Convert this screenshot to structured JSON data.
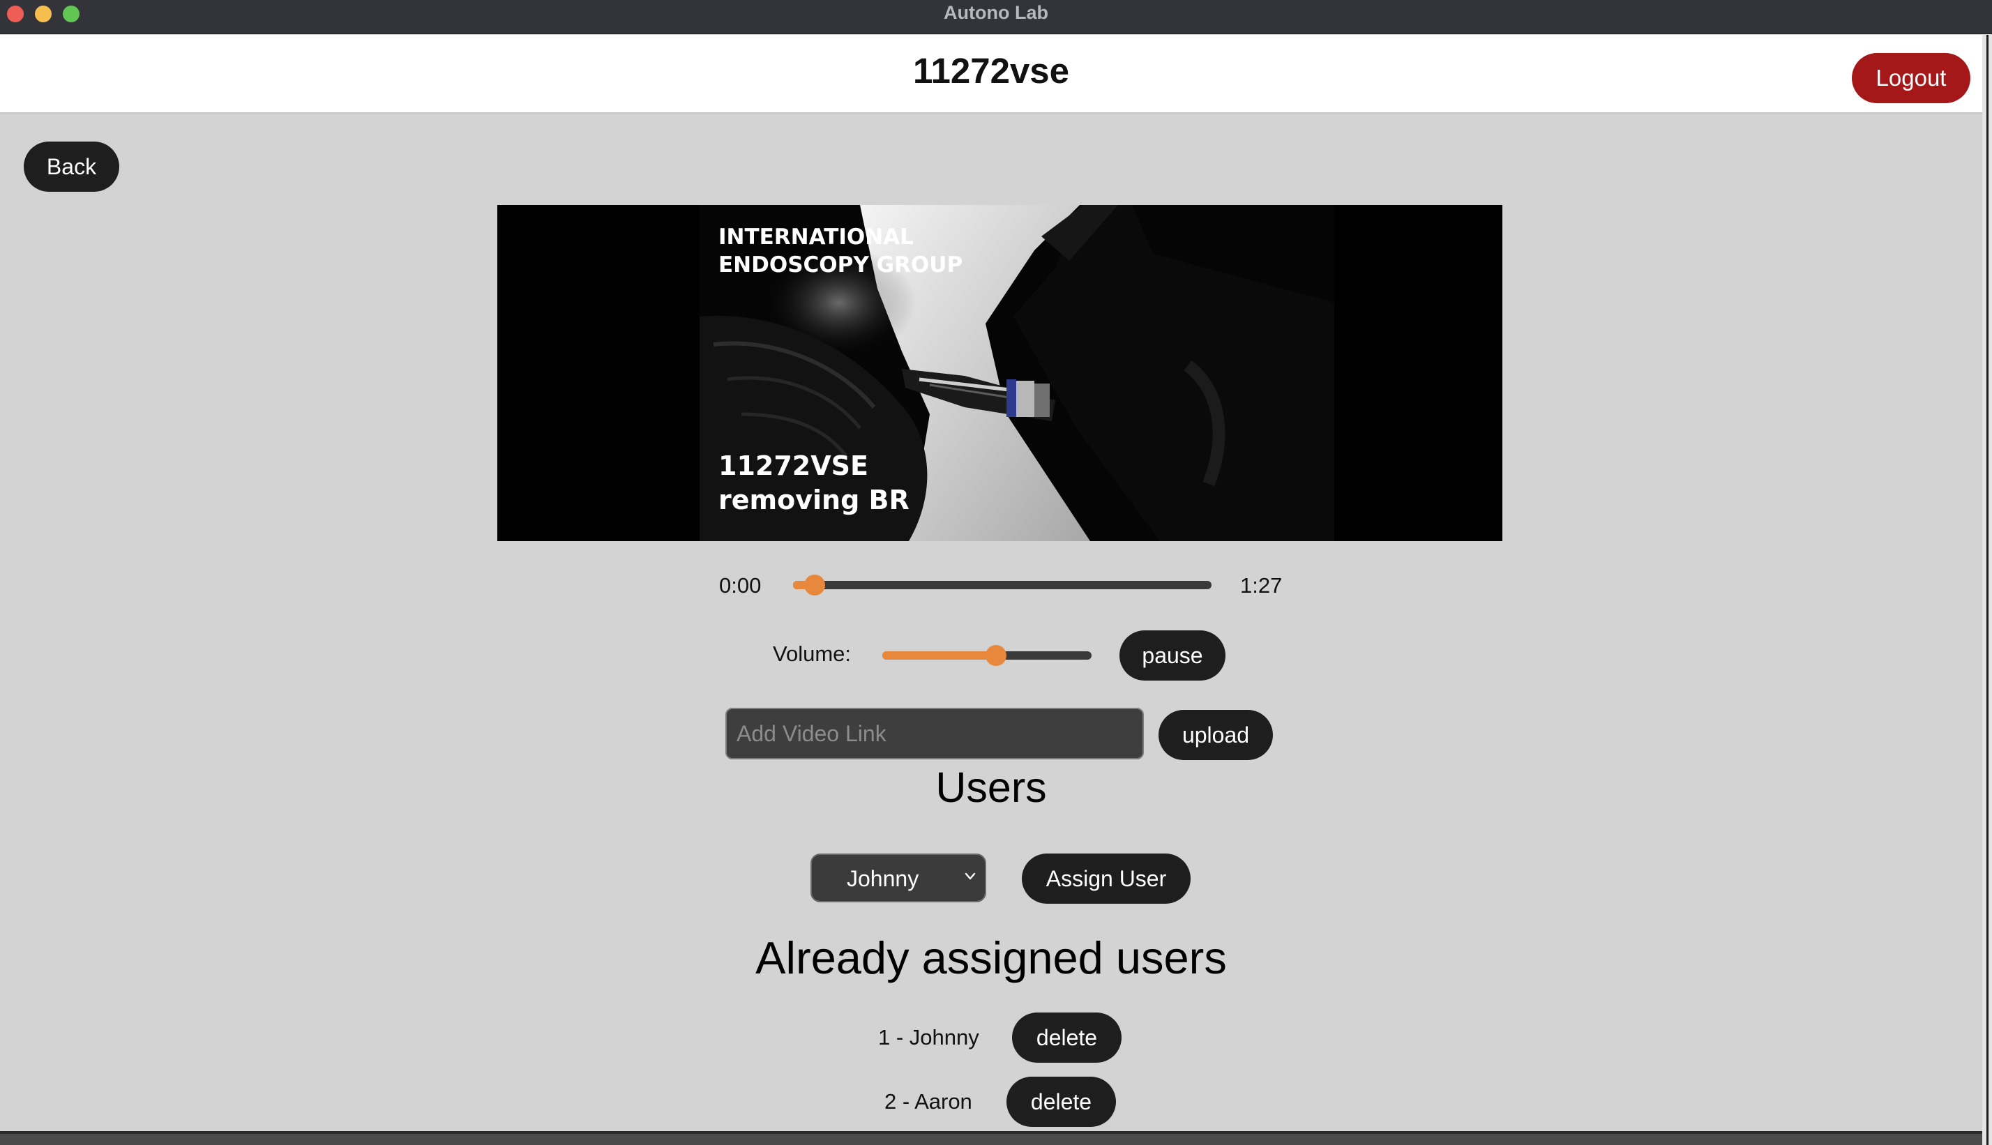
{
  "window": {
    "title": "Autono Lab"
  },
  "header": {
    "title": "11272vse",
    "logout_label": "Logout"
  },
  "nav": {
    "back_label": "Back"
  },
  "video": {
    "overlay_top_line1": "INTERNATIONAL",
    "overlay_top_line2": "ENDOSCOPY GROUP",
    "overlay_bottom_line1": "11272VSE",
    "overlay_bottom_line2": "removing BR"
  },
  "player": {
    "current_time": "0:00",
    "duration": "1:27",
    "seek_fraction": 0.03,
    "volume_label": "Volume:",
    "volume_fraction": 0.5,
    "pause_label": "pause"
  },
  "upload": {
    "placeholder": "Add Video Link",
    "value": "",
    "button_label": "upload"
  },
  "users": {
    "heading": "Users",
    "selected_user": "Johnny",
    "assign_label": "Assign User"
  },
  "assigned": {
    "heading": "Already assigned users",
    "items": [
      {
        "label": "1 - Johnny",
        "delete_label": "delete"
      },
      {
        "label": "2 - Aaron",
        "delete_label": "delete"
      }
    ]
  },
  "colors": {
    "accent": "#e8883c",
    "logout": "#a4181a",
    "pill": "#1e1e1e",
    "background": "#d3d3d3"
  }
}
